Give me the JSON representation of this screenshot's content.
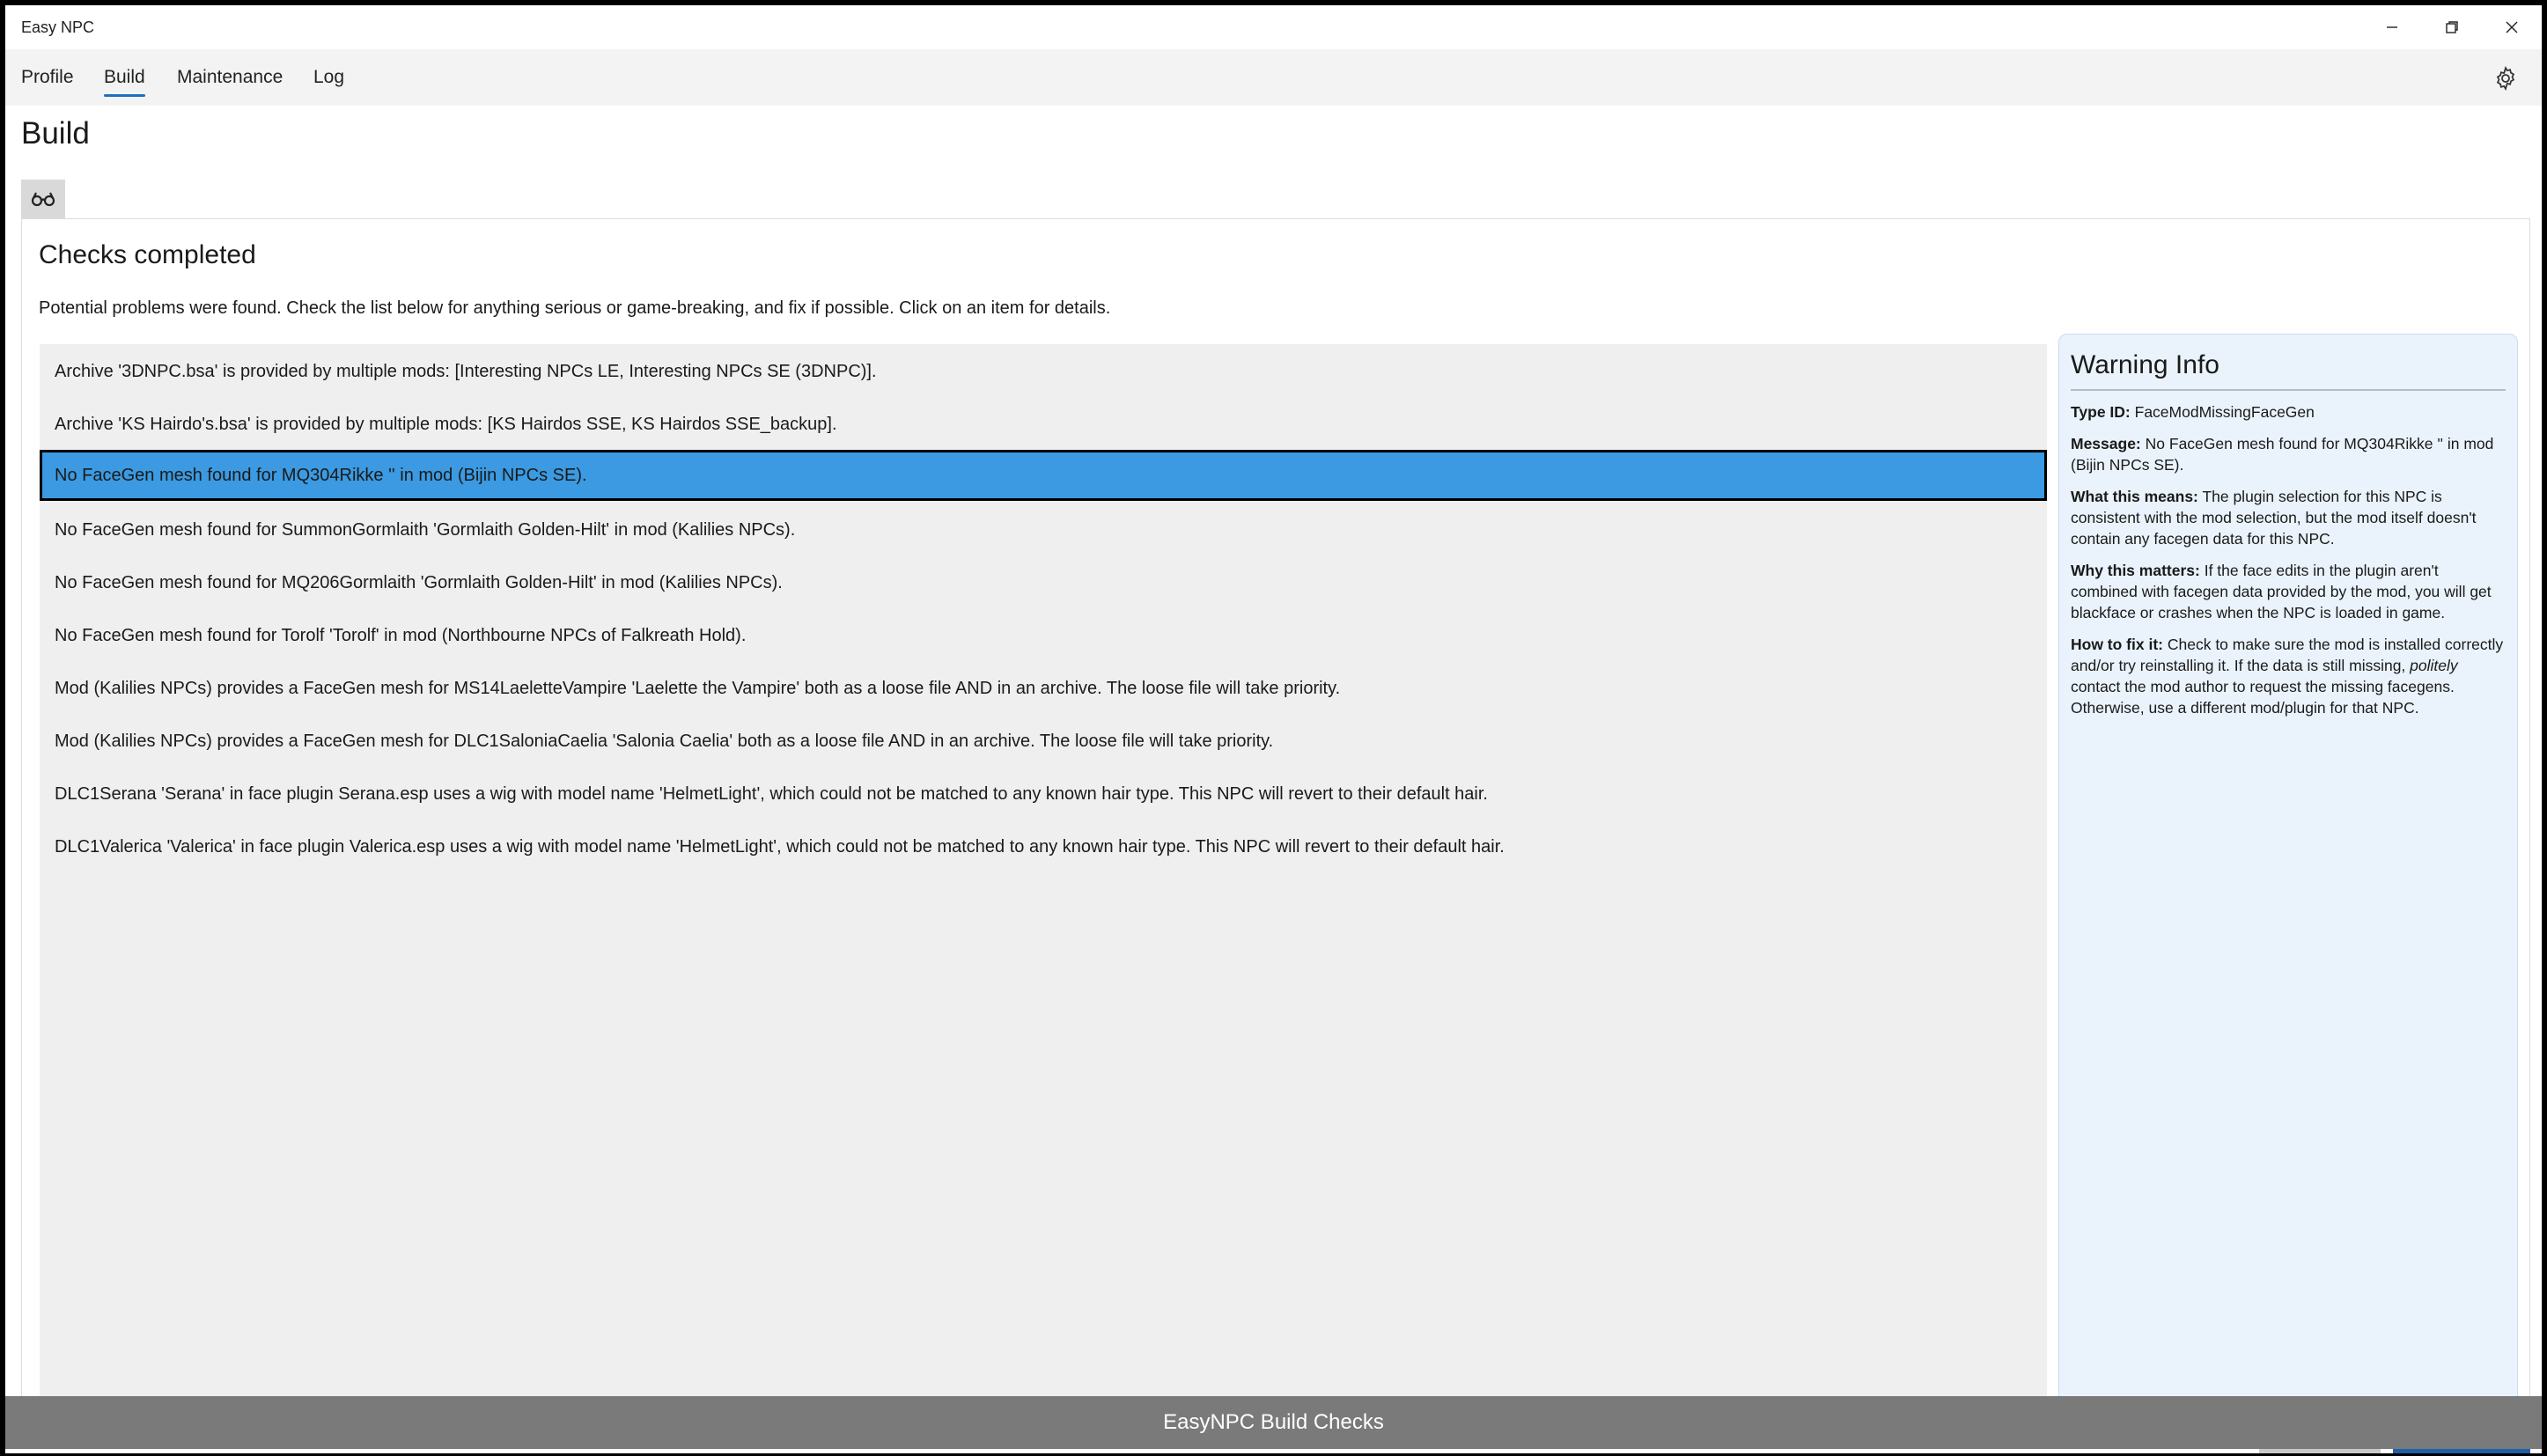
{
  "window": {
    "title": "Easy NPC"
  },
  "menu": {
    "items": [
      "Profile",
      "Build",
      "Maintenance",
      "Log"
    ],
    "active": "Build"
  },
  "page": {
    "title": "Build"
  },
  "checks": {
    "title": "Checks completed",
    "description": "Potential problems were found. Check the list below for anything serious or game-breaking, and fix if possible. Click on an item for details.",
    "items": [
      "Archive '3DNPC.bsa' is provided by multiple mods: [Interesting NPCs LE, Interesting NPCs SE (3DNPC)].",
      "Archive 'KS Hairdo's.bsa' is provided by multiple mods: [KS Hairdos SSE, KS Hairdos SSE_backup].",
      "No FaceGen mesh found for MQ304Rikke '' in mod (Bijin NPCs SE).",
      "No FaceGen mesh found for SummonGormlaith 'Gormlaith Golden-Hilt' in mod (Kalilies NPCs).",
      "No FaceGen mesh found for MQ206Gormlaith 'Gormlaith Golden-Hilt' in mod (Kalilies NPCs).",
      "No FaceGen mesh found for Torolf 'Torolf' in mod (Northbourne NPCs of Falkreath Hold).",
      "Mod (Kalilies NPCs) provides a FaceGen mesh for MS14LaeletteVampire 'Laelette the Vampire' both as a loose file AND in an archive. The loose file will take priority.",
      "Mod (Kalilies NPCs) provides a FaceGen mesh for DLC1SaloniaCaelia 'Salonia Caelia' both as a loose file AND in an archive. The loose file will take priority.",
      "DLC1Serana 'Serana' in face plugin Serana.esp uses a wig with model name 'HelmetLight', which could not be matched to any known hair type. This NPC will revert to their default hair.",
      "DLC1Valerica 'Valerica' in face plugin Valerica.esp uses a wig with model name 'HelmetLight', which could not be matched to any known hair type. This NPC will revert to their default hair."
    ],
    "selected_index": 2
  },
  "warning_info": {
    "title": "Warning Info",
    "type_id_label": "Type ID:",
    "type_id": "FaceModMissingFaceGen",
    "message_label": "Message:",
    "message": "No FaceGen mesh found for MQ304Rikke '' in mod (Bijin NPCs SE).",
    "what_label": "What this means:",
    "what": "The plugin selection for this NPC is consistent with the mod selection, but the mod itself doesn't contain any facegen data for this NPC.",
    "why_label": "Why this matters:",
    "why": "If the face edits in the plugin aren't combined with facegen data provided by the mod, you will get blackface or crashes when the NPC is loaded in game.",
    "fix_label": "How to fix it:",
    "fix_before": "Check to make sure the mod is installed correctly and/or try reinstalling it. If the data is still missing,",
    "fix_emphasis": "politely",
    "fix_after": "contact the mod author to request the missing facegens. Otherwise, use a different mod/plugin for that NPC."
  },
  "toast": {
    "text": "EasyNPC Build Checks"
  },
  "colors": {
    "accent": "#1f6fbf",
    "selected_row": "#3b9ae1",
    "info_bg": "#eaf3fc",
    "primary_button": "#1f5fa8"
  },
  "icons": [
    "minimize-icon",
    "restore-icon",
    "close-icon",
    "gear-icon",
    "glasses-icon"
  ]
}
